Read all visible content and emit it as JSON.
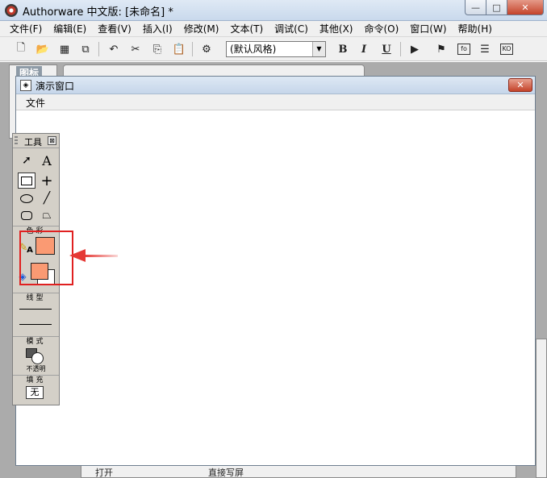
{
  "app": {
    "title": "Authorware 中文版: [未命名] *"
  },
  "window_controls": {
    "minimize": "—",
    "maximize": "□",
    "close": "✕"
  },
  "menubar": {
    "items": [
      "文件(F)",
      "编辑(E)",
      "查看(V)",
      "插入(I)",
      "修改(M)",
      "文本(T)",
      "调试(C)",
      "其他(X)",
      "命令(O)",
      "窗口(W)",
      "帮助(H)"
    ]
  },
  "toolbar": {
    "style_select": "(默认风格)",
    "bold": "B",
    "italic": "I",
    "underline": "U",
    "fo_label": "fo",
    "ko_label": "KO"
  },
  "background": {
    "tab_label": "图标",
    "bottom_left": "打开",
    "bottom_mid": "直接写屏"
  },
  "presentation": {
    "title": "演示窗口",
    "close": "✕",
    "menu": "文件"
  },
  "tools_palette": {
    "title": "工具",
    "close": "⊠",
    "text_tool": "A",
    "color_label": "色彩",
    "line_label": "线型",
    "mode_label": "模式",
    "mode_value": "不透明",
    "fill_label": "填充",
    "fill_value": "无",
    "text_color_glyph": "A"
  },
  "colors": {
    "swatch": "#fa9a73",
    "highlight": "#e02020",
    "arrow": "#e53935"
  }
}
